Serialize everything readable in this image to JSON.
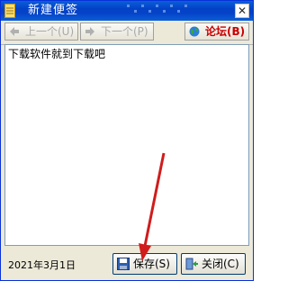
{
  "window": {
    "title": "新建便签",
    "close_glyph": "✕"
  },
  "toolbar": {
    "prev_label": "上一个(U)",
    "next_label": "下一个(P)",
    "forum_label": "论坛(B)"
  },
  "editor": {
    "text": "下载软件就到下载吧"
  },
  "status": {
    "date": "2021年3月1日",
    "save_label": "保存(S)",
    "close_label": "关闭(C)"
  },
  "colors": {
    "titlebar": "#0a5fd8",
    "forum": "#c80000",
    "arrow": "#d01c1c"
  }
}
